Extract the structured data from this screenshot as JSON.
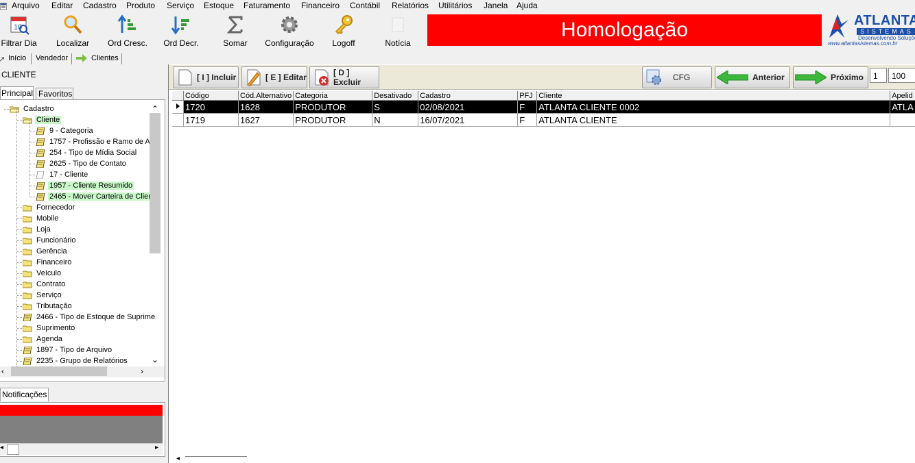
{
  "menu": [
    "Arquivo",
    "Editar",
    "Cadastro",
    "Produto",
    "Serviço",
    "Estoque",
    "Faturamento",
    "Financeiro",
    "Contábil",
    "Relatórios",
    "Utilitários",
    "Janela",
    "Ajuda"
  ],
  "toolbar": {
    "filtrar_dia": "Filtrar Dia",
    "localizar": "Localizar",
    "ord_cresc": "Ord Cresc.",
    "ord_decr": "Ord Decr.",
    "somar": "Somar",
    "configuracao": "Configuração",
    "logoff": "Logoff",
    "noticia": "Notícia",
    "calendar_day": "10"
  },
  "banner": "Homologação",
  "logo": {
    "name": "ATLANTA",
    "sub": "SISTEMAS",
    "tagline": "Desenvolvendo Soluções",
    "url": "www.atlantasistemas.com.br"
  },
  "nav_tabs": {
    "inicio": "Início",
    "vendedor": "Vendedor",
    "clientes": "Clientes"
  },
  "left": {
    "title": "CLIENTE",
    "tab_principal": "Principal",
    "tab_favoritos": "Favoritos",
    "tree": [
      {
        "label": "Cadastro",
        "level": 0,
        "open": true
      },
      {
        "label": "Cliente",
        "level": 1,
        "open": true,
        "hl": true
      },
      {
        "label": "9 - Categoria",
        "level": 2,
        "item": true
      },
      {
        "label": "1757 - Profissão e Ramo de Ati",
        "level": 2,
        "item": true
      },
      {
        "label": "254 - Tipo de Mídia Social",
        "level": 2,
        "item": true
      },
      {
        "label": "2625 - Tipo de Contato",
        "level": 2,
        "item": true
      },
      {
        "label": "17 - Cliente",
        "level": 2,
        "item": true,
        "blank": true
      },
      {
        "label": "1957 - Cliente Resumido",
        "level": 2,
        "item": true,
        "hl": true
      },
      {
        "label": "2465 - Mover Carteira de Client",
        "level": 2,
        "item": true,
        "hl": true
      },
      {
        "label": "Fornecedor",
        "level": 1
      },
      {
        "label": "Mobile",
        "level": 1
      },
      {
        "label": "Loja",
        "level": 1
      },
      {
        "label": "Funcionário",
        "level": 1
      },
      {
        "label": "Gerência",
        "level": 1
      },
      {
        "label": "Financeiro",
        "level": 1
      },
      {
        "label": "Veículo",
        "level": 1
      },
      {
        "label": "Contrato",
        "level": 1
      },
      {
        "label": "Serviço",
        "level": 1
      },
      {
        "label": "Tributação",
        "level": 1
      },
      {
        "label": "2466 - Tipo de Estoque de Suprime",
        "level": 1,
        "item": true
      },
      {
        "label": "Suprimento",
        "level": 1
      },
      {
        "label": "Agenda",
        "level": 1
      },
      {
        "label": "1897 - Tipo de Arquivo",
        "level": 1,
        "item": true
      },
      {
        "label": "2235 - Grupo de Relatórios",
        "level": 1,
        "item": true
      }
    ],
    "notif_tab": "Notificações"
  },
  "actions": {
    "incluir": "[ I ] Incluir",
    "editar": "[ E ] Editar",
    "excluir": "[ D ] Excluir",
    "cfg": "CFG",
    "anterior": "Anterior",
    "proximo": "Próximo",
    "page": "1",
    "page_size": "100"
  },
  "grid": {
    "columns": [
      "Código",
      "Cód.Alternativo",
      "Categoria",
      "Desativado",
      "Cadastro",
      "PFJ",
      "Cliente",
      "Apelid"
    ],
    "rows": [
      [
        "1720",
        "1628",
        "PRODUTOR",
        "S",
        "02/08/2021",
        "F",
        "ATLANTA CLIENTE 0002",
        "ATLA"
      ],
      [
        "1719",
        "1627",
        "PRODUTOR",
        "N",
        "16/07/2021",
        "F",
        "ATLANTA CLIENTE",
        ""
      ]
    ]
  },
  "colors": {
    "banner": "#ff0000",
    "highlight": "#c8f7c8",
    "selected_row": "#000000"
  }
}
